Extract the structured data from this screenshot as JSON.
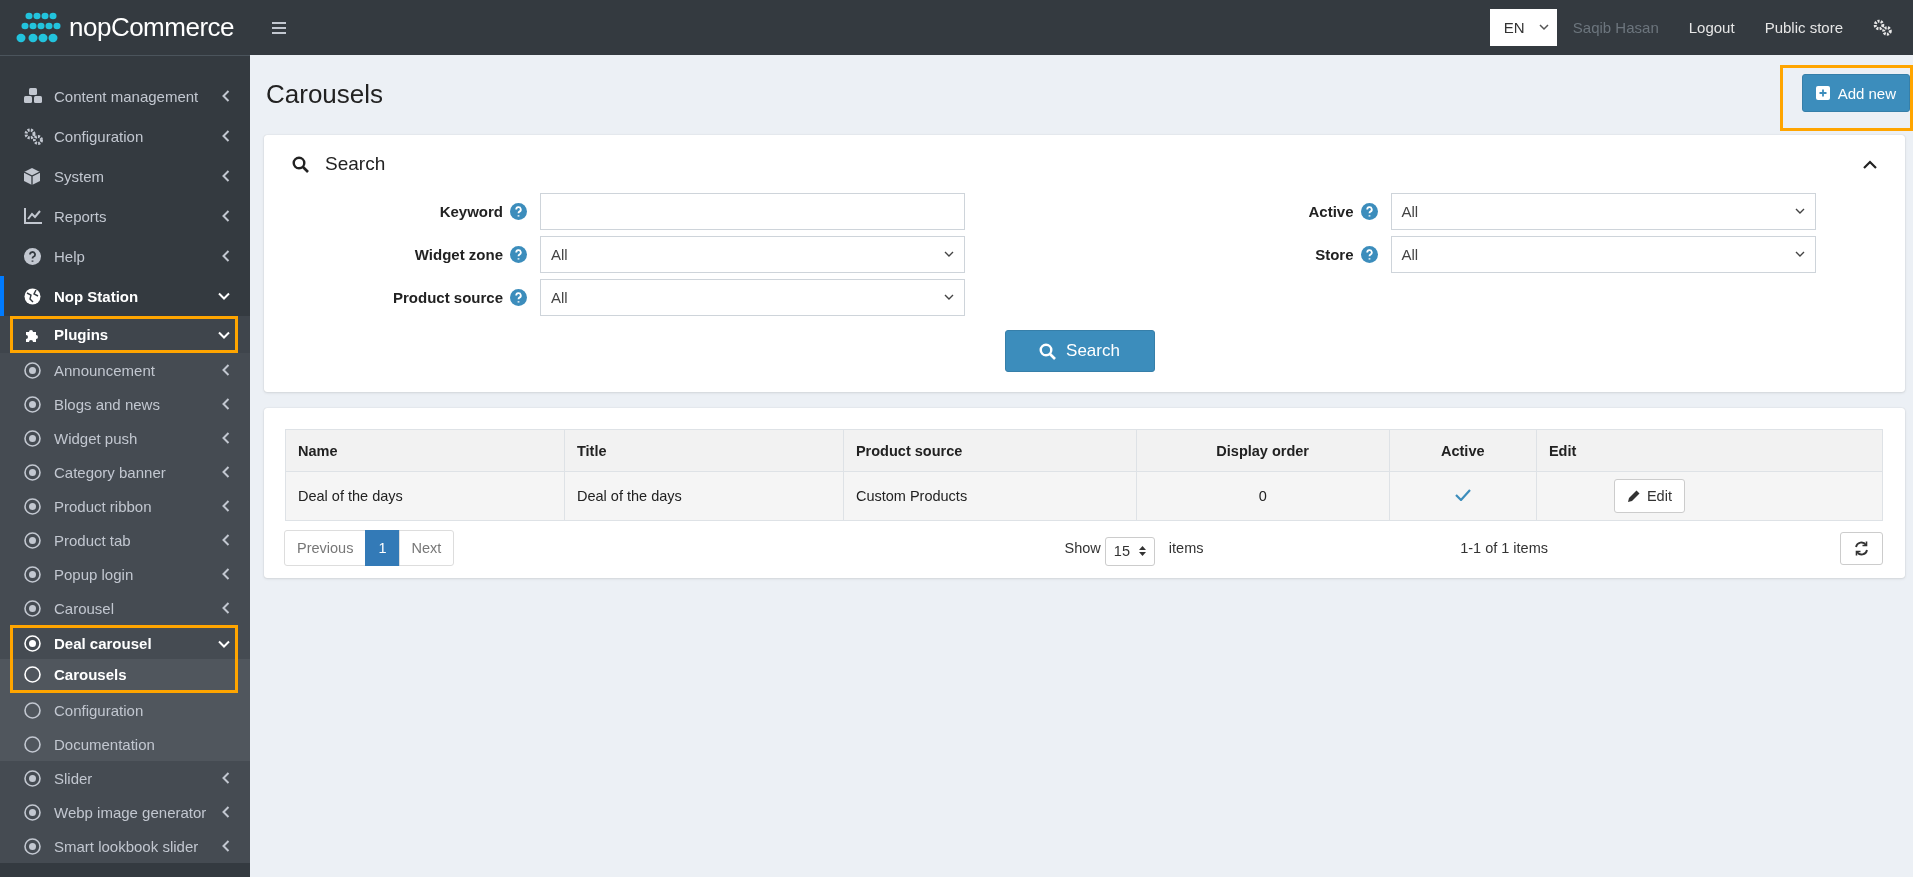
{
  "brand": {
    "name": "nopCommerce"
  },
  "header": {
    "language": "EN",
    "user": "Saqib Hasan",
    "links": [
      "Logout",
      "Public store"
    ]
  },
  "sidebar": {
    "items": [
      {
        "label": "Content management",
        "expanded": false,
        "highlighted": false
      },
      {
        "label": "Configuration",
        "expanded": false,
        "highlighted": false
      },
      {
        "label": "System",
        "expanded": false,
        "highlighted": false
      },
      {
        "label": "Reports",
        "expanded": false,
        "highlighted": false
      },
      {
        "label": "Help",
        "expanded": false,
        "highlighted": false
      },
      {
        "label": "Nop Station",
        "expanded": true,
        "highlighted": false,
        "children": [
          {
            "label": "Plugins",
            "expanded": true,
            "highlighted": true,
            "children": [
              {
                "label": "Announcement",
                "expanded": false,
                "highlighted": false
              },
              {
                "label": "Blogs and news",
                "expanded": false,
                "highlighted": false
              },
              {
                "label": "Widget push",
                "expanded": false,
                "highlighted": false
              },
              {
                "label": "Category banner",
                "expanded": false,
                "highlighted": false
              },
              {
                "label": "Product ribbon",
                "expanded": false,
                "highlighted": false
              },
              {
                "label": "Product tab",
                "expanded": false,
                "highlighted": false
              },
              {
                "label": "Popup login",
                "expanded": false,
                "highlighted": false
              },
              {
                "label": "Carousel",
                "expanded": false,
                "highlighted": false
              },
              {
                "label": "Deal carousel",
                "expanded": true,
                "highlighted": true,
                "children": [
                  {
                    "label": "Carousels",
                    "selected": true,
                    "highlighted": true
                  },
                  {
                    "label": "Configuration",
                    "selected": false,
                    "highlighted": false
                  },
                  {
                    "label": "Documentation",
                    "selected": false,
                    "highlighted": false
                  }
                ]
              },
              {
                "label": "Slider",
                "expanded": false,
                "highlighted": false
              },
              {
                "label": "Webp image generator",
                "expanded": false,
                "highlighted": false
              },
              {
                "label": "Smart lookbook slider",
                "expanded": false,
                "highlighted": false
              }
            ]
          }
        ]
      }
    ]
  },
  "page": {
    "title": "Carousels",
    "add_button": {
      "label": "Add new",
      "highlighted": true
    }
  },
  "search": {
    "title": "Search",
    "expanded": true,
    "fields": [
      {
        "label": "Keyword",
        "kind": "text"
      },
      {
        "label": "Widget zone",
        "kind": "select",
        "value": "All"
      },
      {
        "label": "Product source",
        "kind": "select",
        "value": "All"
      },
      {
        "label": "Active",
        "kind": "select",
        "value": "All"
      },
      {
        "label": "Store",
        "kind": "select",
        "value": "All"
      }
    ],
    "button": "Search"
  },
  "table": {
    "columns": [
      {
        "label": "Name"
      },
      {
        "label": "Title"
      },
      {
        "label": "Product source"
      },
      {
        "label": "Display order"
      },
      {
        "label": "Active"
      },
      {
        "label": "Edit"
      }
    ],
    "rows": [
      {
        "name": "Deal of the days",
        "title": "Deal of the days",
        "product_source": "Custom Products",
        "display_order": "0",
        "active": true,
        "edit": "Edit"
      }
    ]
  },
  "pager": {
    "pages": [
      {
        "label": "Previous",
        "selected": false
      },
      {
        "label": "1",
        "selected": true
      },
      {
        "label": "Next",
        "selected": false
      }
    ],
    "show_label": "Show",
    "page_size": "15",
    "items_label": "items",
    "summary": "1-1 of 1 items"
  }
}
